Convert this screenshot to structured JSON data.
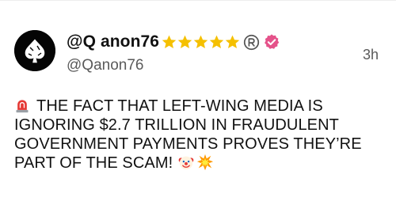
{
  "post": {
    "display_name": "@Q anon76",
    "badges": {
      "stars": 5,
      "star_color": "#f5c000",
      "registered_icon": "registered-icon",
      "verified_icon": "verified-icon",
      "verified_color": "#e5528a"
    },
    "handle": "@Qanon76",
    "timestamp": "3h",
    "body": "THE FACT THAT LEFT-WING MEDIA IS IGNORING $2.7 TRILLION IN FRAUDULENT GOVERNMENT PAYMENTS PROVES THEY’RE PART OF THE SCAM!",
    "emojis": {
      "leading": "siren-emoji",
      "trailing": [
        "clown-emoji",
        "collision-emoji"
      ]
    }
  }
}
